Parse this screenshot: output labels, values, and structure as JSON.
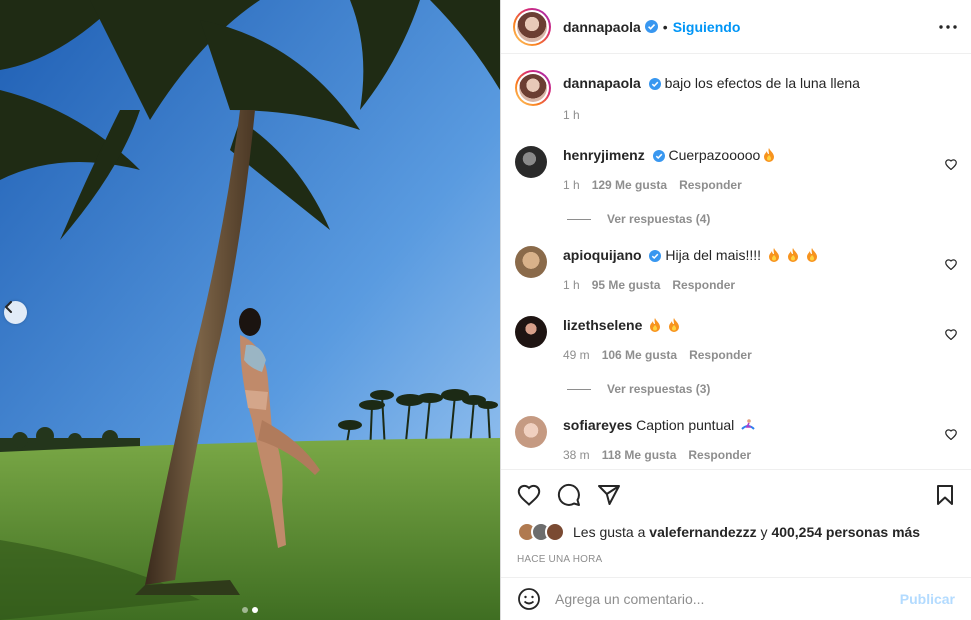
{
  "post": {
    "username": "dannapaola",
    "follow_separator": "•",
    "follow_status": "Siguiendo",
    "more_icon": "more-horizontal-icon",
    "photo_dots": 2,
    "photo_active_dot": 2
  },
  "caption": {
    "username": "dannapaola",
    "text": "bajo los efectos de la luna llena",
    "time": "1 h"
  },
  "comments": [
    {
      "username": "henryjimenz",
      "verified": true,
      "text": "Cuerpazooooo",
      "flames": 1,
      "time": "1 h",
      "likes": "129 Me gusta",
      "reply": "Responder",
      "view_replies": "Ver respuestas (4)",
      "avatar_color": "#3a3a3a"
    },
    {
      "username": "apioquijano",
      "verified": true,
      "text": "Hija del mais!!!!",
      "flames": 3,
      "time": "1 h",
      "likes": "95 Me gusta",
      "reply": "Responder",
      "view_replies": "",
      "avatar_color": "#c49a6c"
    },
    {
      "username": "lizethselene",
      "verified": false,
      "text": "",
      "flames": 2,
      "time": "49 m",
      "likes": "106 Me gusta",
      "reply": "Responder",
      "view_replies": "Ver respuestas (3)",
      "avatar_color": "#2a1d1a"
    },
    {
      "username": "sofiareyes",
      "verified": false,
      "text": "Caption puntual",
      "flames": 0,
      "time": "38 m",
      "likes": "118 Me gusta",
      "reply": "Responder",
      "view_replies": "",
      "avatar_color": "#e8c2b0"
    }
  ],
  "likes_line": {
    "prefix": "Les gusta a",
    "first_user": "valefernandezzz",
    "conjunction": "y",
    "others": "400,254 personas más"
  },
  "time_ago": "HACE UNA HORA",
  "add_comment": {
    "placeholder": "Agrega un comentario...",
    "publish": "Publicar"
  },
  "colors": {
    "accent": "#0095f6",
    "publish_disabled": "#b3dbff",
    "verified": "#3897f0"
  }
}
